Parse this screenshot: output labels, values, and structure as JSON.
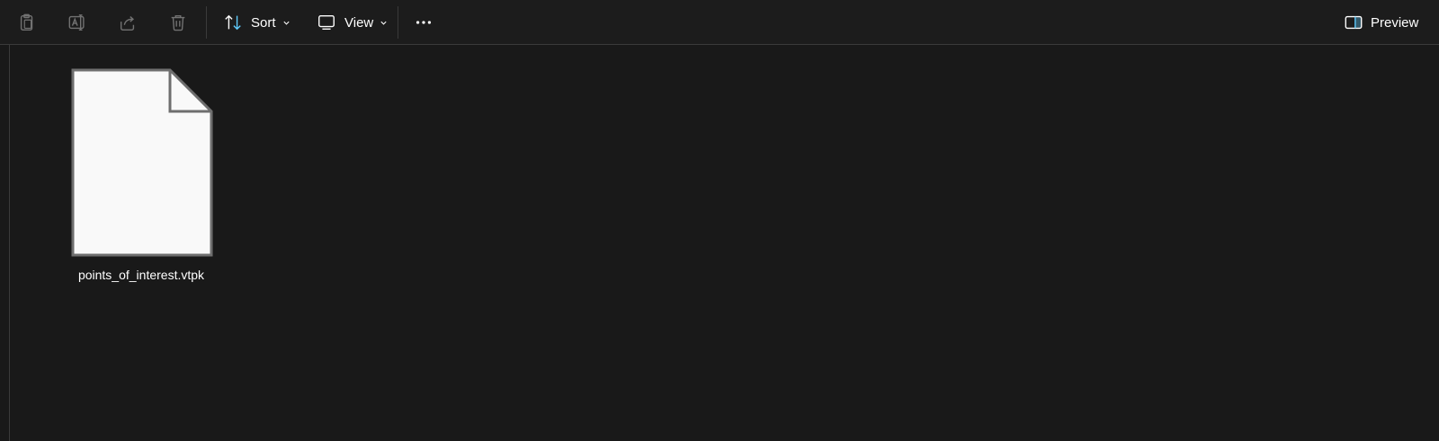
{
  "toolbar": {
    "buttons": [
      {
        "icon": "clipboard-icon",
        "enabled": false
      },
      {
        "icon": "rename-icon",
        "enabled": false
      },
      {
        "icon": "share-icon",
        "enabled": false
      },
      {
        "icon": "trash-icon",
        "enabled": false
      }
    ],
    "sort_label": "Sort",
    "view_label": "View",
    "more_icon": "more-icon",
    "preview_label": "Preview",
    "accent_color": "#60cdff"
  },
  "files": [
    {
      "name": "points_of_interest.vtpk",
      "icon": "blank-file-icon"
    }
  ]
}
